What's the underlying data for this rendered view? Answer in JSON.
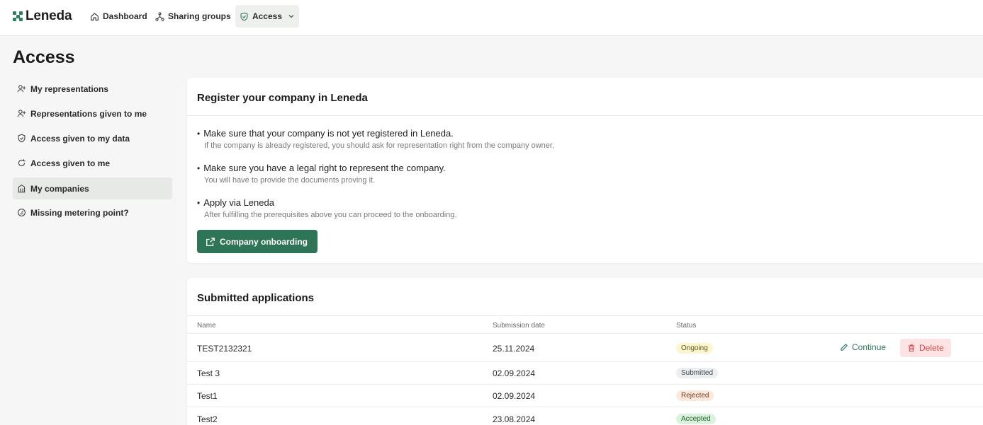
{
  "brand": {
    "name": "Leneda",
    "accent": "#2e7558"
  },
  "nav": [
    {
      "label": "Dashboard",
      "icon": "home-icon"
    },
    {
      "label": "Sharing groups",
      "icon": "share-icon"
    },
    {
      "label": "Access",
      "icon": "shield-icon",
      "active": true
    }
  ],
  "page": {
    "title": "Access"
  },
  "sidebar": {
    "items": [
      {
        "label": "My representations",
        "icon": "user-plus-icon"
      },
      {
        "label": "Representations given to me",
        "icon": "user-plus-icon"
      },
      {
        "label": "Access given to my data",
        "icon": "shield-icon"
      },
      {
        "label": "Access given to me",
        "icon": "refresh-icon"
      },
      {
        "label": "My companies",
        "icon": "building-icon",
        "active": true
      },
      {
        "label": "Missing metering point?",
        "icon": "gauge-icon"
      }
    ]
  },
  "register": {
    "title": "Register your company in Leneda",
    "requirements": [
      {
        "main": "Make sure that your company is not yet registered in Leneda.",
        "sub": "If the company is already registered, you should ask for representation right from the company owner."
      },
      {
        "main": "Make sure you have a legal right to represent the company.",
        "sub": "You will have to provide the documents proving it."
      },
      {
        "main": "Apply via Leneda",
        "sub": "After fulfilling the prerequisites above you can proceed to the onboarding."
      }
    ],
    "button_label": "Company onboarding"
  },
  "applications": {
    "title": "Submitted applications",
    "columns": {
      "name": "Name",
      "date": "Submission date",
      "status": "Status"
    },
    "rows": [
      {
        "name": "TEST2132321",
        "date": "25.11.2024",
        "status": "Ongoing",
        "continue": "Continue",
        "delete": "Delete"
      },
      {
        "name": "Test 3",
        "date": "02.09.2024",
        "status": "Submitted"
      },
      {
        "name": "Test1",
        "date": "02.09.2024",
        "status": "Rejected"
      },
      {
        "name": "Test2",
        "date": "23.08.2024",
        "status": "Accepted"
      }
    ]
  }
}
